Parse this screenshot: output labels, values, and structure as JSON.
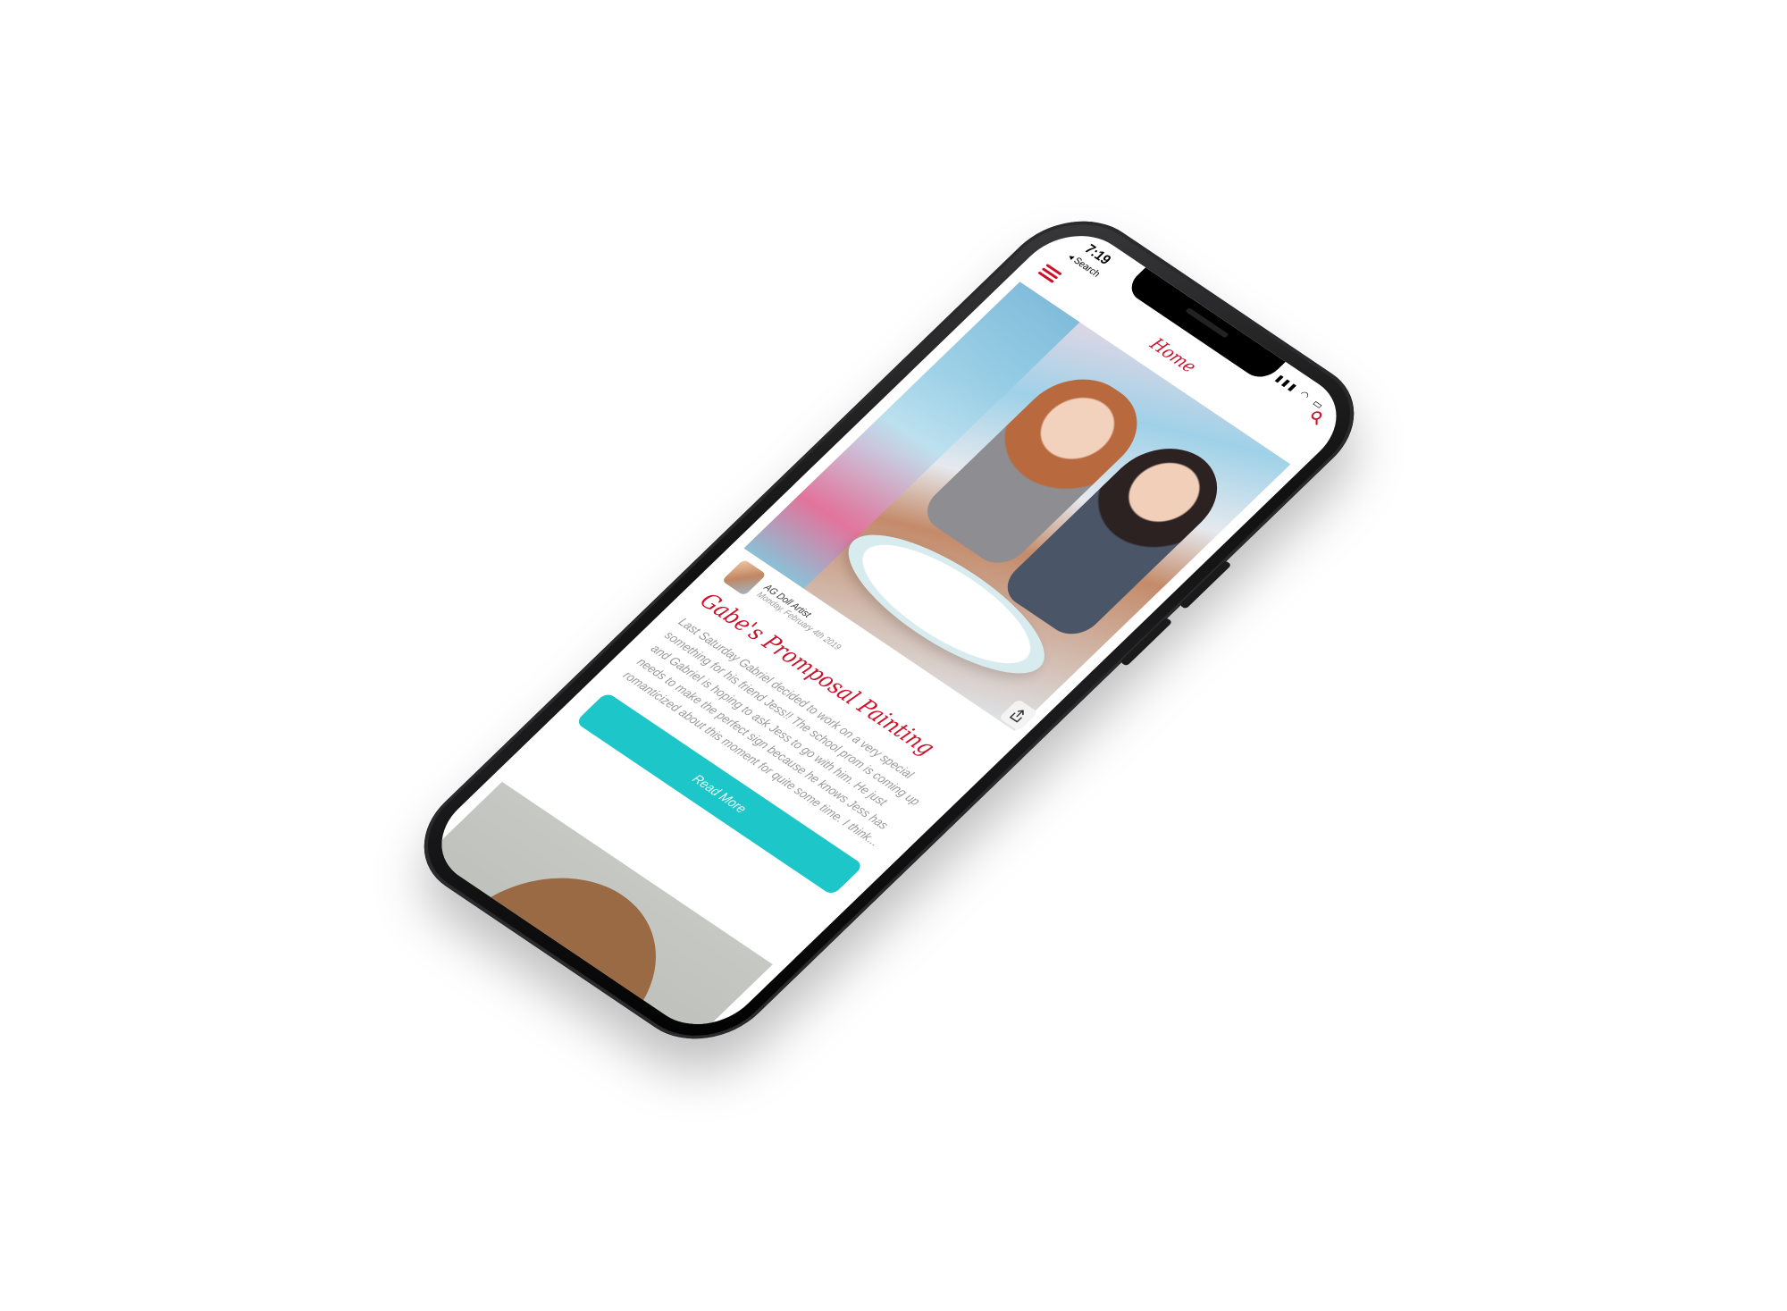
{
  "status_bar": {
    "time": "7:19",
    "back_label": "◂ Search"
  },
  "nav": {
    "title": "Home"
  },
  "post": {
    "author": "AG Doll Artist",
    "date": "Monday, February 4th 2019",
    "title": "Gabe's Promposal Painting",
    "excerpt": "Last Saturday Gabriel decided to work on a very special something for his friend Jess!! The school prom is coming up and Gabriel is hoping to ask Jess to go with him. He just needs to make the perfect sign because he knows Jess has romanticized about this moment for quite some time. I think...",
    "read_more_label": "Read More"
  },
  "colors": {
    "accent_red": "#d0102b",
    "button_teal": "#1cc6c9"
  },
  "icons": {
    "menu": "hamburger-icon",
    "search": "search-icon",
    "share": "share-icon"
  }
}
